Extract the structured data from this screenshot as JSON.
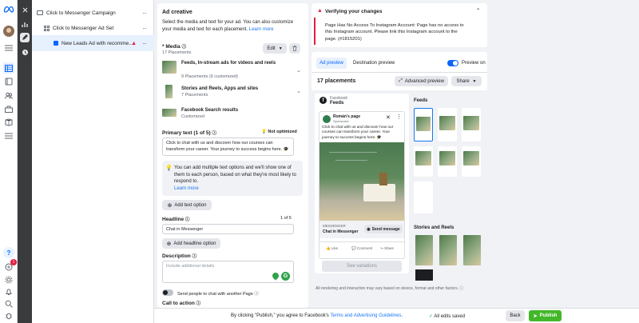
{
  "colors": {
    "brand": "#0866ff",
    "publish": "#42b72a",
    "error": "#e41e3f",
    "link": "#1877f2"
  },
  "rail": {
    "badge_count": "1"
  },
  "tree": {
    "campaign": "Click to Messenger Campaign",
    "adset": "Click to Messenger Ad Set",
    "ad": "New Leads Ad with recomme...",
    "dots": "···"
  },
  "editor": {
    "title": "Ad creative",
    "description": "Select the media and text for your ad. You can also customize your media and text for each placement.",
    "learn_more": "Learn more",
    "media_label": "Media",
    "media_required": "*",
    "placements_count": "17 Placements",
    "edit_label": "Edit",
    "placement_groups": [
      {
        "name": "Feeds, In-stream ads for videos and reels",
        "sub": "9 Placements (9 customized)"
      },
      {
        "name": "Stories and Reels, Apps and sites",
        "sub": "7 Placements"
      },
      {
        "name": "Facebook Search results",
        "sub": "Customized"
      }
    ],
    "primary_text_label": "Primary text (1 of 5)",
    "not_optimized": "Not optimized",
    "primary_text_value": "Click to chat with us and discover how our courses can transform your career. Your journey to success begins here. 🎓",
    "tip_text": "You can add multiple text options and we'll show one of them to each person, based on what they're most likely to respond to.",
    "tip_learn_more": "Learn more",
    "add_text_option": "Add text option",
    "headline_label": "Headline",
    "headline_count": "1 of 5",
    "headline_value": "Chat in Messenger",
    "add_headline_option": "Add headline option",
    "description_label": "Description",
    "description_placeholder": "Include additional details",
    "toggle_label": "Send people to chat with another Page",
    "cta_label": "Call to action"
  },
  "verify": {
    "title": "Verifying your changes",
    "message": "Page Has No Access To Instagram Account: Page has no access to this Instagram account. Please link this Instagram account to the page. (#1815201)"
  },
  "preview": {
    "tabs": [
      "Ad preview",
      "Destination preview"
    ],
    "preview_toggle_label": "Preview on",
    "placements_heading": "17 placements",
    "advanced_preview": "Advanced preview",
    "share": "Share",
    "platform": "Facebook",
    "placement": "Feeds",
    "page_name": "Román's page",
    "sponsored": "Sponsored",
    "ad_text": "Click to chat with us and discover how our courses can transform your career. Your journey to success begins here. 🎓",
    "cta_source": "MESSENGER",
    "cta_headline": "Chat in Messenger",
    "send_message": "Send message",
    "actions": [
      "Like",
      "Comment",
      "Share"
    ],
    "see_variations": "See variations",
    "footnote": "All rendering and interaction may vary based on device, format and other factors.",
    "feeds_label": "Feeds",
    "stories_label": "Stories and Reels"
  },
  "footer": {
    "legal_prefix": "By clicking \"Publish,\" you agree to Facebook's",
    "legal_link": "Terms and Advertising Guidelines",
    "legal_suffix": ".",
    "saved": "All edits saved",
    "back": "Back",
    "publish": "Publish"
  }
}
